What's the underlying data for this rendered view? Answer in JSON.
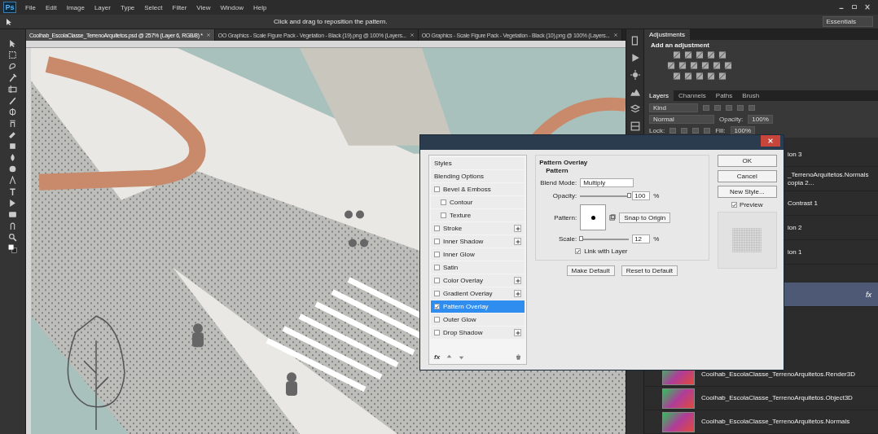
{
  "app": {
    "logo": "Ps",
    "menu": [
      "File",
      "Edit",
      "Image",
      "Layer",
      "Type",
      "Select",
      "Filter",
      "View",
      "Window",
      "Help"
    ]
  },
  "options_bar": {
    "hint": "Click and drag to reposition the pattern.",
    "workspace": "Essentials"
  },
  "document_tabs": [
    {
      "label": "Coolhab_EscolaClasse_TerrenoArquitetos.psd @ 257% (Layer 6, RGB/8) *",
      "selected": true
    },
    {
      "label": "OO Graphics - Scale Figure Pack - Vegetation - Black (19).png @ 100% (Layers...",
      "selected": false
    },
    {
      "label": "OO Graphics - Scale Figure Pack - Vegetation - Black (10).png @ 100% (Layers...",
      "selected": false
    }
  ],
  "adjustments": {
    "tab": "Adjustments",
    "heading": "Add an adjustment"
  },
  "layers_panel": {
    "tabs": [
      {
        "label": "Layers",
        "selected": true
      },
      {
        "label": "Channels",
        "selected": false
      },
      {
        "label": "Paths",
        "selected": false
      },
      {
        "label": "Brush",
        "selected": false
      }
    ],
    "filter": "Kind",
    "blend_mode": "Normal",
    "opacity_label": "Opacity:",
    "opacity": "100%",
    "lock_label": "Lock:",
    "fill_label": "Fill:",
    "fill": "100%",
    "layers": [
      {
        "kind": "partial",
        "name": "ion 3",
        "selected": false
      },
      {
        "kind": "partial",
        "name": "_TerrenoArquitetos.Normals copia 2...",
        "selected": false
      },
      {
        "kind": "partial",
        "name": "Contrast 1",
        "selected": false
      },
      {
        "kind": "partial",
        "name": "ion 2",
        "selected": false
      },
      {
        "kind": "partial",
        "name": "ion 1",
        "selected": false
      },
      {
        "kind": "effects",
        "effects_label": "fx",
        "selected": true
      },
      {
        "kind": "thumb",
        "name": "Coolhab_EscolaClasse_TerrenoArquitetos.Render3D",
        "selected": false
      },
      {
        "kind": "thumb",
        "name": "Coolhab_EscolaClasse_TerrenoArquitetos.Object3D",
        "selected": false
      },
      {
        "kind": "thumb",
        "name": "Coolhab_EscolaClasse_TerrenoArquitetos.Normals",
        "selected": false
      }
    ]
  },
  "dialog": {
    "styles": [
      {
        "kind": "header",
        "label": "Styles",
        "selected": false,
        "add_button": false
      },
      {
        "kind": "header",
        "label": "Blending Options",
        "selected": false,
        "add_button": false
      },
      {
        "kind": "effect",
        "label": "Bevel & Emboss",
        "checked": false,
        "selected": false,
        "add_button": false
      },
      {
        "kind": "sub",
        "label": "Contour",
        "checked": false,
        "selected": false,
        "add_button": false
      },
      {
        "kind": "sub",
        "label": "Texture",
        "checked": false,
        "selected": false,
        "add_button": false
      },
      {
        "kind": "effect",
        "label": "Stroke",
        "checked": false,
        "selected": false,
        "add_button": true
      },
      {
        "kind": "effect",
        "label": "Inner Shadow",
        "checked": false,
        "selected": false,
        "add_button": true
      },
      {
        "kind": "effect",
        "label": "Inner Glow",
        "checked": false,
        "selected": false,
        "add_button": false
      },
      {
        "kind": "effect",
        "label": "Satin",
        "checked": false,
        "selected": false,
        "add_button": false
      },
      {
        "kind": "effect",
        "label": "Color Overlay",
        "checked": false,
        "selected": false,
        "add_button": true
      },
      {
        "kind": "effect",
        "label": "Gradient Overlay",
        "checked": false,
        "selected": false,
        "add_button": true
      },
      {
        "kind": "effect",
        "label": "Pattern Overlay",
        "checked": true,
        "selected": true,
        "add_button": false
      },
      {
        "kind": "effect",
        "label": "Outer Glow",
        "checked": false,
        "selected": false,
        "add_button": false
      },
      {
        "kind": "effect",
        "label": "Drop Shadow",
        "checked": false,
        "selected": false,
        "add_button": true
      }
    ],
    "footer_label": "fx",
    "group_title": "Pattern Overlay",
    "subgroup_title": "Pattern",
    "blend_mode_label": "Blend Mode:",
    "blend_mode": "Multiply",
    "opacity_label": "Opacity:",
    "opacity": {
      "level": 1,
      "value": "100",
      "unit": "%"
    },
    "pattern_label": "Pattern:",
    "snap_button": "Snap to Origin",
    "scale_label": "Scale:",
    "scale": {
      "level": 0.01,
      "value": "12",
      "unit": "%"
    },
    "link_with_layer": {
      "label": "Link with Layer",
      "checked": true
    },
    "make_default": "Make Default",
    "reset_default": "Reset to Default",
    "ok": "OK",
    "cancel": "Cancel",
    "new_style": "New Style...",
    "preview": {
      "label": "Preview",
      "checked": true
    }
  }
}
